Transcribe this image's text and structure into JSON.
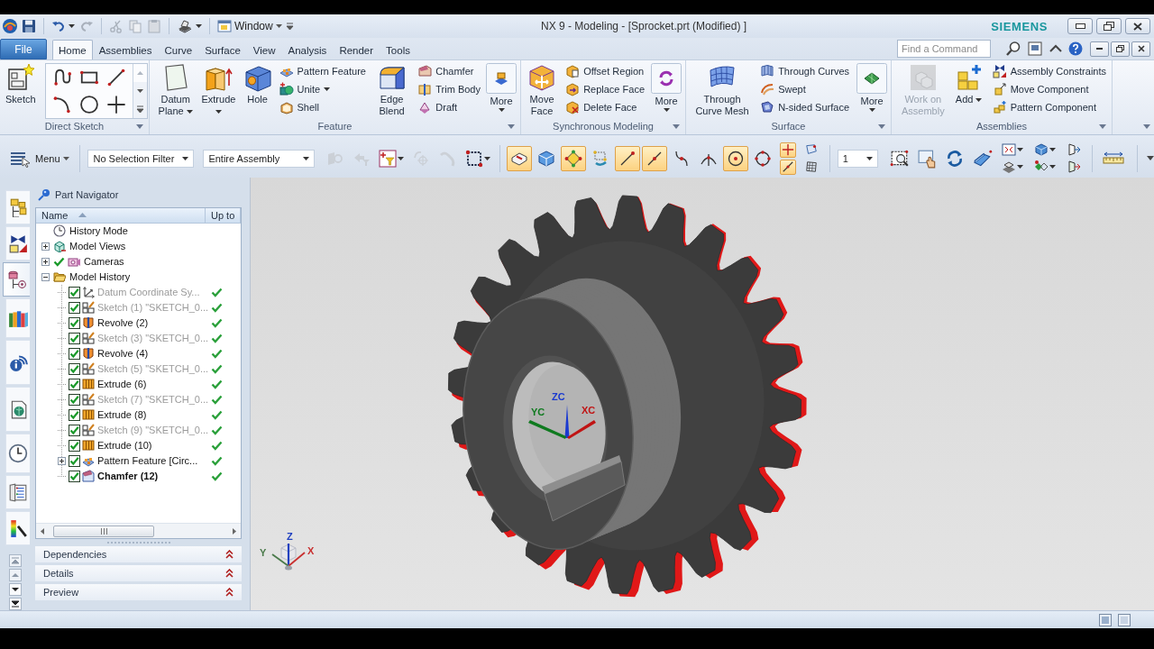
{
  "title_bar": {
    "window_menu": "Window",
    "title": "NX 9 - Modeling - [Sprocket.prt (Modified) ]",
    "brand": "SIEMENS"
  },
  "menu_bar": {
    "tabs": [
      {
        "label": "File",
        "kind": "file",
        "selected": false
      },
      {
        "label": "Home",
        "kind": "tab",
        "selected": true
      },
      {
        "label": "Assemblies",
        "kind": "tab",
        "selected": false
      },
      {
        "label": "Curve",
        "kind": "tab",
        "selected": false
      },
      {
        "label": "Surface",
        "kind": "tab",
        "selected": false
      },
      {
        "label": "View",
        "kind": "tab",
        "selected": false
      },
      {
        "label": "Analysis",
        "kind": "tab",
        "selected": false
      },
      {
        "label": "Render",
        "kind": "tab",
        "selected": false
      },
      {
        "label": "Tools",
        "kind": "tab",
        "selected": false
      }
    ],
    "command_search": {
      "placeholder": "Find a Command"
    }
  },
  "ribbon": {
    "groups": [
      {
        "title": "Direct Sketch",
        "items": [
          {
            "kind": "large",
            "label": "Sketch",
            "dropdown": false,
            "disabled": false
          },
          {
            "kind": "gallery"
          }
        ]
      },
      {
        "title": "Feature",
        "items": [
          {
            "kind": "large",
            "label": "Datum Plane",
            "dropdown": true,
            "disabled": false
          },
          {
            "kind": "large",
            "label": "Extrude",
            "dropdown": true,
            "disabled": false
          },
          {
            "kind": "large",
            "label": "Hole",
            "dropdown": false,
            "disabled": false
          },
          {
            "kind": "stack",
            "items": [
              {
                "label": "Pattern Feature",
                "dropdown": false
              },
              {
                "label": "Unite",
                "dropdown": true
              },
              {
                "label": "Shell",
                "dropdown": false
              }
            ]
          },
          {
            "kind": "large",
            "label": "Edge Blend",
            "dropdown": false,
            "disabled": false
          },
          {
            "kind": "stack",
            "items": [
              {
                "label": "Chamfer",
                "dropdown": false
              },
              {
                "label": "Trim Body",
                "dropdown": false
              },
              {
                "label": "Draft",
                "dropdown": false
              }
            ]
          },
          {
            "kind": "more",
            "label": "More"
          }
        ]
      },
      {
        "title": "Synchronous Modeling",
        "items": [
          {
            "kind": "large",
            "label": "Move Face",
            "dropdown": false,
            "disabled": false
          },
          {
            "kind": "stack",
            "items": [
              {
                "label": "Offset Region",
                "dropdown": false
              },
              {
                "label": "Replace Face",
                "dropdown": false
              },
              {
                "label": "Delete Face",
                "dropdown": false
              }
            ]
          },
          {
            "kind": "more",
            "label": "More"
          }
        ]
      },
      {
        "title": "Surface",
        "items": [
          {
            "kind": "large",
            "label": "Through Curve Mesh",
            "dropdown": false,
            "disabled": false
          },
          {
            "kind": "stack",
            "items": [
              {
                "label": "Through Curves",
                "dropdown": false
              },
              {
                "label": "Swept",
                "dropdown": false
              },
              {
                "label": "N-sided Surface",
                "dropdown": false
              }
            ]
          },
          {
            "kind": "more",
            "label": "More"
          }
        ]
      },
      {
        "title": "Assemblies",
        "items": [
          {
            "kind": "large",
            "label": "Work on Assembly",
            "dropdown": false,
            "disabled": true
          },
          {
            "kind": "large",
            "label": "Add",
            "dropdown": true,
            "disabled": false
          },
          {
            "kind": "stack",
            "items": [
              {
                "label": "Assembly Constraints",
                "dropdown": false
              },
              {
                "label": "Move Component",
                "dropdown": false
              },
              {
                "label": "Pattern Component",
                "dropdown": false
              }
            ]
          }
        ]
      }
    ]
  },
  "toolbar": {
    "menu": "Menu",
    "selection_filter": "No Selection Filter",
    "selection_scope": "Entire Assembly",
    "selection_tools": [
      {
        "disabled": true
      },
      {
        "disabled": true
      },
      {
        "disabled": false
      },
      {
        "disabled": true
      },
      {
        "disabled": true
      },
      {
        "disabled": false
      }
    ],
    "snap_tools": [
      {
        "selected": true
      },
      {
        "selected": false
      },
      {
        "selected": true
      },
      {
        "selected": false
      },
      {
        "selected": true
      },
      {
        "selected": true
      },
      {
        "selected": false
      },
      {
        "selected": false
      },
      {
        "selected": true
      },
      {
        "selected": false
      },
      {
        "selected": true
      },
      {
        "selected": true
      },
      {
        "selected": false
      },
      {
        "selected": false
      }
    ],
    "work_layer": "1"
  },
  "resource_bar": {
    "tabs": [
      {
        "selected": false
      },
      {
        "selected": false
      },
      {
        "selected": true
      },
      {
        "selected": false
      },
      {
        "selected": false
      },
      {
        "selected": false
      },
      {
        "selected": false
      },
      {
        "selected": false
      },
      {
        "selected": false
      }
    ]
  },
  "navigator": {
    "title": "Part Navigator",
    "columns": [
      {
        "label": "Name",
        "sorted": true
      },
      {
        "label": "Up to",
        "sorted": false
      }
    ],
    "tree": [
      {
        "label": "History Mode",
        "kind": "history",
        "checked": false
      },
      {
        "label": "Model Views",
        "kind": "views",
        "checked": false,
        "expanded": false
      },
      {
        "label": "Cameras",
        "kind": "cameras",
        "checked": true,
        "expanded": false
      },
      {
        "label": "Model History",
        "kind": "folder",
        "checked": false,
        "expanded": true,
        "children": [
          {
            "label": "Datum Coordinate Sy...",
            "kind": "datum",
            "checked": true,
            "dimmed": true,
            "current": false,
            "up_to": true
          },
          {
            "label": "Sketch (1) \"SKETCH_0...",
            "kind": "sketch",
            "checked": true,
            "dimmed": true,
            "current": false,
            "up_to": true
          },
          {
            "label": "Revolve (2)",
            "kind": "revolve",
            "checked": true,
            "dimmed": false,
            "current": false,
            "up_to": true
          },
          {
            "label": "Sketch (3) \"SKETCH_0...",
            "kind": "sketch",
            "checked": true,
            "dimmed": true,
            "current": false,
            "up_to": true
          },
          {
            "label": "Revolve (4)",
            "kind": "revolve",
            "checked": true,
            "dimmed": false,
            "current": false,
            "up_to": true
          },
          {
            "label": "Sketch (5) \"SKETCH_0...",
            "kind": "sketch",
            "checked": true,
            "dimmed": true,
            "current": false,
            "up_to": true
          },
          {
            "label": "Extrude (6)",
            "kind": "extrude",
            "checked": true,
            "dimmed": false,
            "current": false,
            "up_to": true
          },
          {
            "label": "Sketch (7) \"SKETCH_0...",
            "kind": "sketch",
            "checked": true,
            "dimmed": true,
            "current": false,
            "up_to": true
          },
          {
            "label": "Extrude (8)",
            "kind": "extrude",
            "checked": true,
            "dimmed": false,
            "current": false,
            "up_to": true
          },
          {
            "label": "Sketch (9) \"SKETCH_0...",
            "kind": "sketch",
            "checked": true,
            "dimmed": true,
            "current": false,
            "up_to": true
          },
          {
            "label": "Extrude (10)",
            "kind": "extrude",
            "checked": true,
            "dimmed": false,
            "current": false,
            "up_to": true
          },
          {
            "label": "Pattern Feature [Circ...",
            "kind": "pattern",
            "checked": true,
            "dimmed": false,
            "current": false,
            "up_to": true,
            "expanded": false
          },
          {
            "label": "Chamfer (12)",
            "kind": "chamfer",
            "checked": true,
            "dimmed": false,
            "current": true,
            "up_to": true
          }
        ]
      }
    ],
    "sections": [
      {
        "label": "Dependencies",
        "expanded": false
      },
      {
        "label": "Details",
        "expanded": false
      },
      {
        "label": "Preview",
        "expanded": false
      }
    ]
  },
  "viewport": {
    "work_axes": [
      {
        "label": "ZC",
        "color": "#1a3ad0"
      },
      {
        "label": "XC",
        "color": "#c01414"
      },
      {
        "label": "YC",
        "color": "#0f7a1f"
      }
    ],
    "view_axes": [
      {
        "label": "Z",
        "color": "#2040c0"
      },
      {
        "label": "X",
        "color": "#c83030"
      },
      {
        "label": "Y",
        "color": "#4a7a4a"
      }
    ]
  }
}
